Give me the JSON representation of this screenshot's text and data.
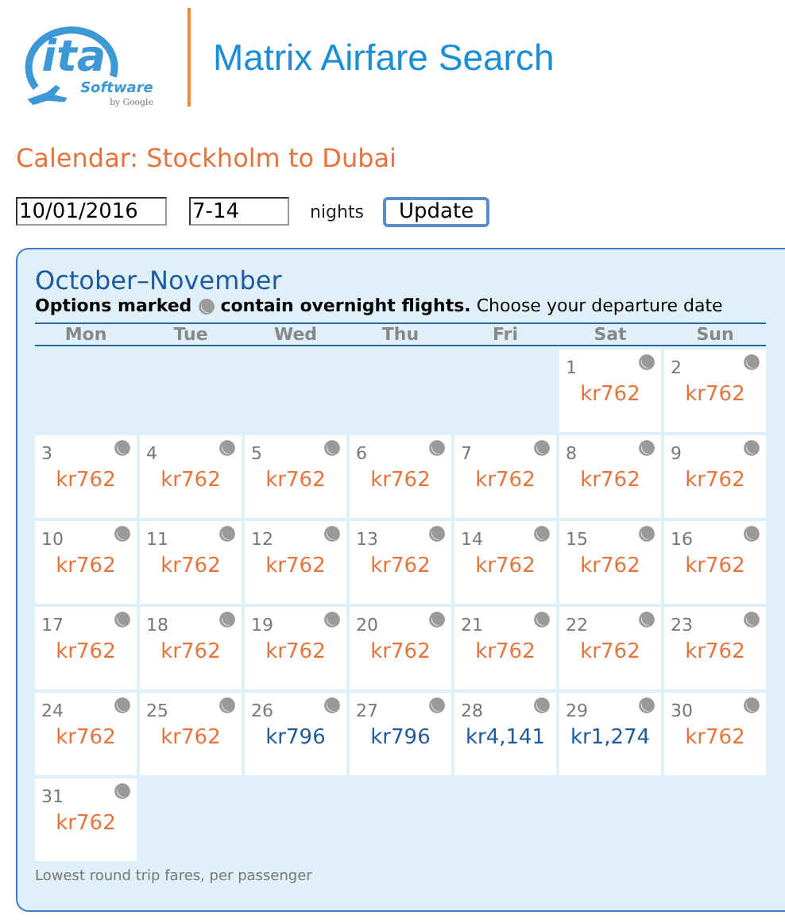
{
  "logo": {
    "wordmark": "ita",
    "product": "Software",
    "byline": "by Google"
  },
  "title": "Matrix Airfare Search",
  "heading": "Calendar: Stockholm to Dubai",
  "search": {
    "date": "10/01/2016",
    "nights": "7-14",
    "nights_label": "nights",
    "button": "Update"
  },
  "calendar": {
    "title": "October–November",
    "legend_label": "Options marked",
    "legend_text": "**contain overnight flights.** Choose your departure date",
    "weekdays": [
      "Mon",
      "Tue",
      "Wed",
      "Thu",
      "Fri",
      "Sat",
      "Sun"
    ],
    "weeks": [
      [
        {
          "kind": "blank"
        },
        {
          "kind": "blank"
        },
        {
          "kind": "blank"
        },
        {
          "kind": "blank"
        },
        {
          "kind": "blank"
        },
        {
          "date": "1",
          "price": "kr762",
          "cheapest": true,
          "overnight": true
        },
        {
          "date": "2",
          "price": "kr762",
          "cheapest": true,
          "overnight": true
        }
      ],
      [
        {
          "date": "3",
          "price": "kr762",
          "cheapest": true,
          "overnight": true
        },
        {
          "date": "4",
          "price": "kr762",
          "cheapest": true,
          "overnight": true
        },
        {
          "date": "5",
          "price": "kr762",
          "cheapest": true,
          "overnight": true
        },
        {
          "date": "6",
          "price": "kr762",
          "cheapest": true,
          "overnight": true
        },
        {
          "date": "7",
          "price": "kr762",
          "cheapest": true,
          "overnight": true
        },
        {
          "date": "8",
          "price": "kr762",
          "cheapest": true,
          "overnight": true
        },
        {
          "date": "9",
          "price": "kr762",
          "cheapest": true,
          "overnight": true
        }
      ],
      [
        {
          "date": "10",
          "price": "kr762",
          "cheapest": true,
          "overnight": true
        },
        {
          "date": "11",
          "price": "kr762",
          "cheapest": true,
          "overnight": true
        },
        {
          "date": "12",
          "price": "kr762",
          "cheapest": true,
          "overnight": true
        },
        {
          "date": "13",
          "price": "kr762",
          "cheapest": true,
          "overnight": true
        },
        {
          "date": "14",
          "price": "kr762",
          "cheapest": true,
          "overnight": true
        },
        {
          "date": "15",
          "price": "kr762",
          "cheapest": true,
          "overnight": true
        },
        {
          "date": "16",
          "price": "kr762",
          "cheapest": true,
          "overnight": true
        }
      ],
      [
        {
          "date": "17",
          "price": "kr762",
          "cheapest": true,
          "overnight": true
        },
        {
          "date": "18",
          "price": "kr762",
          "cheapest": true,
          "overnight": true
        },
        {
          "date": "19",
          "price": "kr762",
          "cheapest": true,
          "overnight": true
        },
        {
          "date": "20",
          "price": "kr762",
          "cheapest": true,
          "overnight": true
        },
        {
          "date": "21",
          "price": "kr762",
          "cheapest": true,
          "overnight": true
        },
        {
          "date": "22",
          "price": "kr762",
          "cheapest": true,
          "overnight": true
        },
        {
          "date": "23",
          "price": "kr762",
          "cheapest": true,
          "overnight": true
        }
      ],
      [
        {
          "date": "24",
          "price": "kr762",
          "cheapest": true,
          "overnight": true
        },
        {
          "date": "25",
          "price": "kr762",
          "cheapest": true,
          "overnight": true
        },
        {
          "date": "26",
          "price": "kr796",
          "cheapest": false,
          "overnight": true
        },
        {
          "date": "27",
          "price": "kr796",
          "cheapest": false,
          "overnight": true
        },
        {
          "date": "28",
          "price": "kr4,141",
          "cheapest": false,
          "overnight": true
        },
        {
          "date": "29",
          "price": "kr1,274",
          "cheapest": false,
          "overnight": true
        },
        {
          "date": "30",
          "price": "kr762",
          "cheapest": true,
          "overnight": true
        }
      ],
      [
        {
          "date": "31",
          "price": "kr762",
          "cheapest": true,
          "overnight": true
        }
      ]
    ],
    "footnote": "Lowest round trip fares, per passenger"
  }
}
